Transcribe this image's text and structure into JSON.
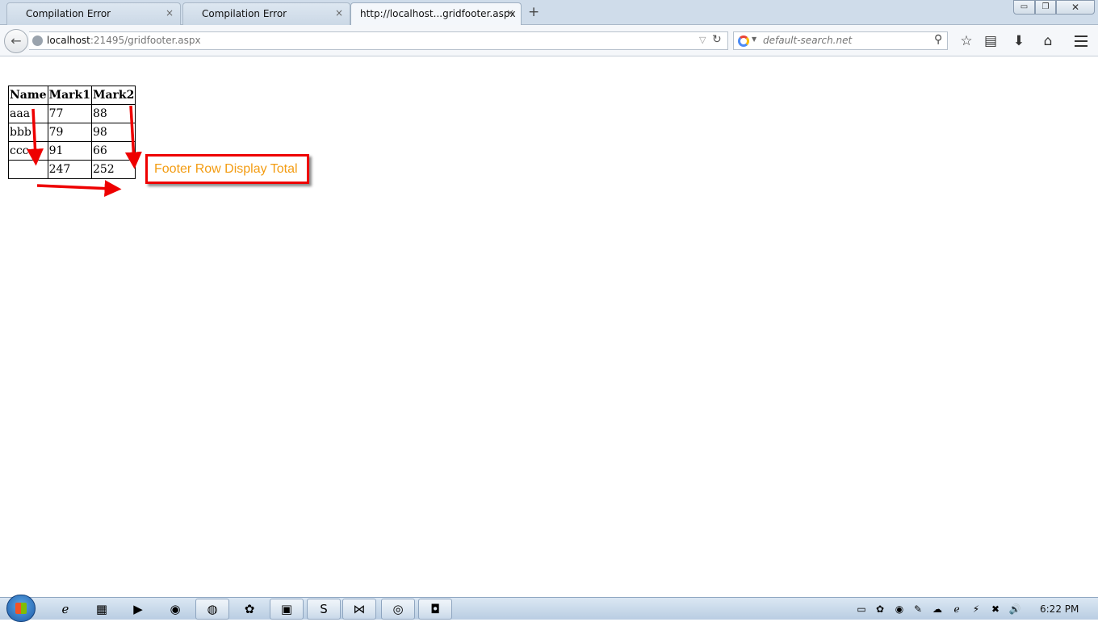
{
  "tabs": [
    {
      "label": "Compilation Error",
      "close": "×"
    },
    {
      "label": "Compilation Error",
      "close": "×"
    },
    {
      "label": "http://localhost...gridfooter.aspx",
      "close": "×",
      "active": true
    }
  ],
  "new_tab": "+",
  "window_controls": {
    "minimize": "▭",
    "restore": "❐",
    "close": "✕"
  },
  "navbar": {
    "back": "←",
    "url_host": "localhost",
    "url_rest": ":21495/gridfooter.aspx",
    "url_dropdown": "▽",
    "reload": "↻",
    "search_placeholder": "default-search.net",
    "search_go": "⚲",
    "bookmark": "☆",
    "reader": "▤",
    "download": "⬇",
    "home": "⌂"
  },
  "grid": {
    "headers": [
      "Name",
      "Mark1",
      "Mark2"
    ],
    "rows": [
      [
        "aaa",
        "77",
        "88"
      ],
      [
        "bbb",
        "79",
        "98"
      ],
      [
        "ccc",
        "91",
        "66"
      ]
    ],
    "footer": [
      "",
      "247",
      "252"
    ]
  },
  "callout": {
    "text": "Footer Row Display Total"
  },
  "colors": {
    "annotation": "#e00000",
    "callout_text": "#f39c12"
  },
  "taskbar": {
    "apps": [
      {
        "icon": "ℯ",
        "name": "internet-explorer-icon"
      },
      {
        "icon": "▦",
        "name": "file-explorer-icon"
      },
      {
        "icon": "▶",
        "name": "media-player-icon"
      },
      {
        "icon": "◉",
        "name": "chrome-icon"
      },
      {
        "icon": "◍",
        "name": "firefox-icon"
      },
      {
        "icon": "✿",
        "name": "paint-app-icon"
      },
      {
        "icon": "▣",
        "name": "folder-sync-icon"
      },
      {
        "icon": "S",
        "name": "skype-icon"
      },
      {
        "icon": "⋈",
        "name": "visual-studio-icon"
      },
      {
        "icon": "◎",
        "name": "tool-app-icon"
      },
      {
        "icon": "◘",
        "name": "office-app-icon"
      }
    ],
    "tray": [
      "▭",
      "✿",
      "◉",
      "✎",
      "☁",
      "ℯ",
      "⚡",
      "✖",
      "🔊"
    ],
    "clock": "6:22 PM"
  }
}
